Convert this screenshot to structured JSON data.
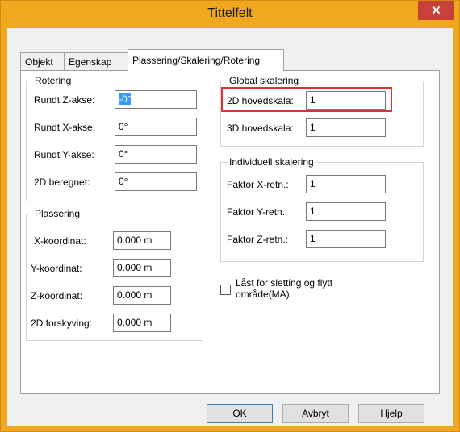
{
  "window": {
    "title": "Tittelfelt",
    "close_glyph": "✕"
  },
  "tabs": [
    {
      "label": "Objekt"
    },
    {
      "label": "Egenskap"
    },
    {
      "label": "Plassering/Skalering/Rotering",
      "active": true
    }
  ],
  "rotation": {
    "group_title": "Rotering",
    "rows": [
      {
        "label": "Rundt Z-akse:",
        "value": "-0°"
      },
      {
        "label": "Rundt X-akse:",
        "value": "0°"
      },
      {
        "label": "Rundt Y-akse:",
        "value": "0°"
      },
      {
        "label": "2D beregnet:",
        "value": "0°"
      }
    ]
  },
  "placement": {
    "group_title": "Plassering",
    "rows": [
      {
        "label": "X-koordinat:",
        "value": "0.000 m"
      },
      {
        "label": "Y-koordinat:",
        "value": "0.000 m"
      },
      {
        "label": "Z-koordinat:",
        "value": "0.000 m"
      },
      {
        "label": "2D forskyving:",
        "value": "0.000 m"
      }
    ]
  },
  "global_scale": {
    "group_title": "Global skalering",
    "rows": [
      {
        "label": "2D hovedskala:",
        "value": "1"
      },
      {
        "label": "3D hovedskala:",
        "value": "1"
      }
    ]
  },
  "individual_scale": {
    "group_title": "Individuell skalering",
    "rows": [
      {
        "label": "Faktor X-retn.:",
        "value": "1"
      },
      {
        "label": "Faktor Y-retn.:",
        "value": "1"
      },
      {
        "label": "Faktor Z-retn.:",
        "value": "1"
      }
    ]
  },
  "lock": {
    "label_line1": "Låst for sletting og flytt",
    "label_line2": "område(MA)",
    "checked": false
  },
  "buttons": {
    "ok": "OK",
    "cancel": "Avbryt",
    "help": "Hjelp"
  },
  "colors": {
    "titlebar": "#f0a81f",
    "close": "#c7403a",
    "selection": "#3399ff",
    "highlight": "#d9343a"
  }
}
